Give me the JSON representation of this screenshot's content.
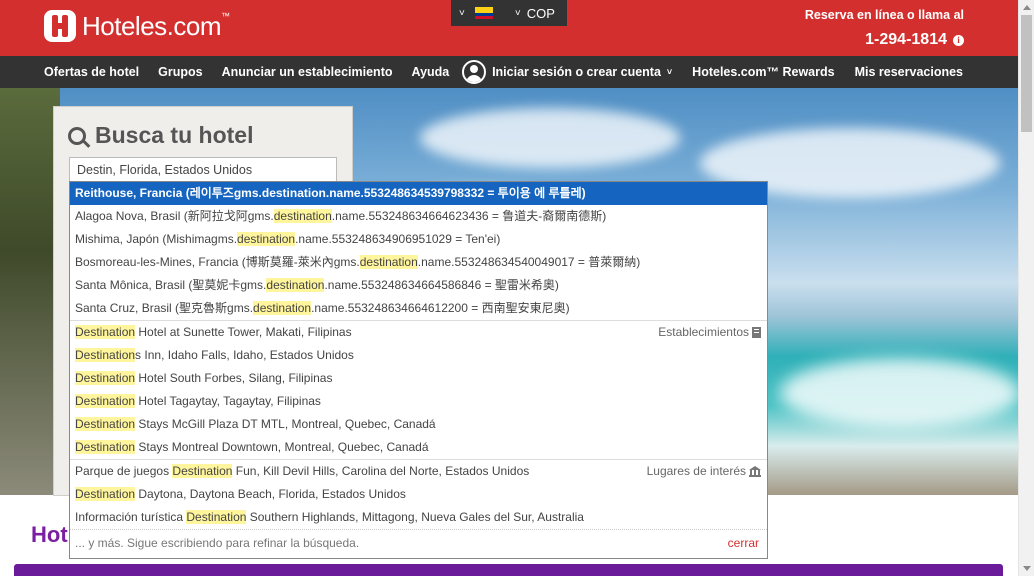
{
  "header": {
    "logo_text": "Hoteles.com",
    "logo_tm": "™",
    "currency": "COP",
    "reserve_text": "Reserva en línea o llama al",
    "phone": "1-294-1814",
    "info_icon": "i"
  },
  "nav": {
    "left": [
      "Ofertas de hotel",
      "Grupos",
      "Anunciar un establecimiento",
      "Ayuda"
    ],
    "signin": "Iniciar sesión o crear cuenta",
    "rewards": "Hoteles.com™ Rewards",
    "reservations": "Mis reservaciones"
  },
  "search": {
    "title": "Busca tu hotel",
    "destination_value": "Destin, Florida, Estados Unidos"
  },
  "dropdown": {
    "selected": "Reithouse, Francia (레이투즈gms.destination.name.553248634539798332 = 투이용 에 루틀레)",
    "cities": [
      [
        "Alagoa Nova, Brasil (新阿拉戈阿gms.",
        "destination",
        ".name.553248634664623436 = 鲁道夫-裔爾南德斯)"
      ],
      [
        "Mishima, Japón (Mishimagms.",
        "destination",
        ".name.553248634906951029 = Ten'ei)"
      ],
      [
        "Bosmoreau-les-Mines, Francia (博斯莫羅-萊米內gms.",
        "destination",
        ".name.553248634540049017 = 普萊爾納)"
      ],
      [
        "Santa Mônica, Brasil (聖莫妮卡gms.",
        "destination",
        ".name.553248634664586846 = 聖雷米希奧)"
      ],
      [
        "Santa Cruz, Brasil (聖克魯斯gms.",
        "destination",
        ".name.553248634664612200 = 西南聖安東尼奧)"
      ]
    ],
    "properties_label": "Establecimientos",
    "properties": [
      [
        "",
        "Destination",
        " Hotel at Sunette Tower, Makati, Filipinas"
      ],
      [
        "",
        "Destination",
        "s Inn, Idaho Falls, Idaho, Estados Unidos"
      ],
      [
        "",
        "Destination",
        " Hotel South Forbes, Silang, Filipinas"
      ],
      [
        "",
        "Destination",
        " Hotel Tagaytay, Tagaytay, Filipinas"
      ],
      [
        "",
        "Destination",
        " Stays McGill Plaza DT MTL, Montreal, Quebec, Canadá"
      ],
      [
        "",
        "Destination",
        " Stays Montreal Downtown, Montreal, Quebec, Canadá"
      ]
    ],
    "landmarks_label": "Lugares de interés",
    "landmarks": [
      [
        "Parque de juegos ",
        "Destination",
        " Fun, Kill Devil Hills, Carolina del Norte, Estados Unidos"
      ],
      [
        "",
        "Destination",
        " Daytona, Daytona Beach, Florida, Estados Unidos"
      ],
      [
        "Información turística ",
        "Destination",
        " Southern Highlands, Mittagong, Nueva Gales del Sur, Australia"
      ]
    ],
    "footer": "... y más. Sigue escribiendo para refinar la búsqueda.",
    "close": "cerrar"
  },
  "below_partial": "Hot",
  "colors": {
    "brand_red": "#d32f2f",
    "nav_dark": "#333333",
    "selected_blue": "#1565c0",
    "highlight": "#fff59d",
    "purple": "#6a1b9a"
  },
  "icons": [
    "hotels-logo-icon",
    "chevron-down-icon",
    "colombia-flag-icon",
    "info-icon",
    "user-avatar-icon",
    "search-icon",
    "building-icon",
    "landmark-icon"
  ]
}
